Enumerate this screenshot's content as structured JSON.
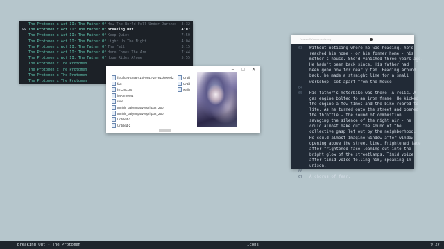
{
  "player": {
    "rows": [
      {
        "marker": "",
        "track": "The Protomen x Act II: The Father Of",
        "title": "How The World Fell Under Darkness",
        "duration": "3:32",
        "current": false
      },
      {
        "marker": ">>",
        "track": "The Protomen x Act II: The Father Of",
        "title": "Breaking Out",
        "duration": "4:07",
        "current": true
      },
      {
        "marker": "",
        "track": "The Protomen x Act II: The Father Of",
        "title": "Keep Quiet",
        "duration": "7:50",
        "current": false
      },
      {
        "marker": "",
        "track": "The Protomen x Act II: The Father Of",
        "title": "Light Up The Night",
        "duration": "4:04",
        "current": false
      },
      {
        "marker": "",
        "track": "The Protomen x Act II: The Father Of",
        "title": "The Fall",
        "duration": "3:15",
        "current": false
      },
      {
        "marker": "",
        "track": "The Protomen x Act II: The Father Of",
        "title": "Here Comes The Arm",
        "duration": "7:44",
        "current": false
      },
      {
        "marker": "",
        "track": "The Protomen x Act II: The Father Of",
        "title": "Hope Rides Alone",
        "duration": "5:55",
        "current": false
      },
      {
        "marker": "",
        "track": "The Protomen x The Protomen",
        "title": "",
        "duration": "",
        "current": false
      },
      {
        "marker": "",
        "track": "The Protomen x The Protomen",
        "title": "",
        "duration": "",
        "current": false
      },
      {
        "marker": "",
        "track": "The Protomen x The Protomen",
        "title": "",
        "duration": "",
        "current": false
      },
      {
        "marker": "",
        "track": "The Protomen x The Protomen",
        "title": "",
        "duration": "",
        "current": false
      }
    ]
  },
  "explorer": {
    "controls": {
      "minimize": "–",
      "maximize": "□",
      "close": "✕"
    },
    "files": [
      "f443fce5-cc58-410f-9842-2e7e10b9eed2",
      "fart",
      "hTCmLOST",
      "lMA.mWML",
      "rose",
      "tumblr_oaiyt08psIvvoprhpo2_250",
      "tumblr_oaiyt08psIvvoprhpo2_250",
      "Untitled-1",
      "Untitled-2"
    ],
    "files2": [
      "Untitl",
      "Untitl",
      "wallh"
    ]
  },
  "editor": {
    "path": "~/wwjstuffs/documents.org",
    "lines": [
      {
        "n": "63",
        "t": "Without noticing where he was heading, he'd"
      },
      {
        "n": "",
        "t": "reached his home - or his former home - his"
      },
      {
        "n": "",
        "t": "mother's house. She'd vanished three years ago."
      },
      {
        "n": "",
        "t": " He hadn't been back since. His father had"
      },
      {
        "n": "",
        "t": "been gone now for nearly ten. Heading around"
      },
      {
        "n": "",
        "t": "back, he made a straight line for a small"
      },
      {
        "n": "",
        "t": "workshop, set apart from the house."
      },
      {
        "n": "64",
        "t": ""
      },
      {
        "n": "65",
        "t": "His father's motorbike was there. A relic. A"
      },
      {
        "n": "",
        "t": "gas engine bolted to an iron frame. He kicked"
      },
      {
        "n": "",
        "t": "the engine a few times and the bike roared to"
      },
      {
        "n": "",
        "t": "life. As he turned onto the street and opened"
      },
      {
        "n": "",
        "t": "the throttle - the sound of combustion"
      },
      {
        "n": "",
        "t": "savaging the silence of the night air - he"
      },
      {
        "n": "",
        "t": "could almost make out the sound of the"
      },
      {
        "n": "",
        "t": "collective gasp let out by the neighborhood."
      },
      {
        "n": "",
        "t": "He could almost imagine window after window"
      },
      {
        "n": "",
        "t": "opening above the street line. Frightened face"
      },
      {
        "n": "",
        "t": "after frightened face leaning out into the"
      },
      {
        "n": "",
        "t": "bright glow of the streetlamps. Timid voice"
      },
      {
        "n": "",
        "t": "after timid voice telling him, speaking in"
      },
      {
        "n": "",
        "t": "unison."
      },
      {
        "n": "66",
        "t": ""
      },
      {
        "n": "67",
        "t": "A chorus of fear."
      }
    ]
  },
  "statusbar": {
    "now_playing": "Breaking Out - The Protomen",
    "workspace": "Icons",
    "clock": "9:27"
  }
}
